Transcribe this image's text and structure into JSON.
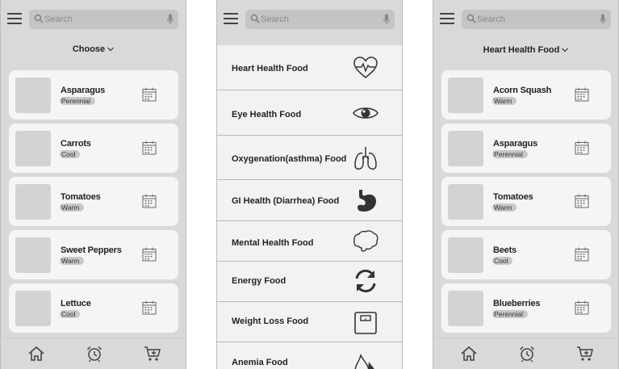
{
  "search": {
    "placeholder": "Search"
  },
  "screen1": {
    "chooser": "Choose",
    "items": [
      {
        "name": "Asparagus",
        "tag": "Perennial"
      },
      {
        "name": "Carrots",
        "tag": "Cool"
      },
      {
        "name": "Tomatoes",
        "tag": "Warm"
      },
      {
        "name": "Sweet Peppers",
        "tag": "Warm"
      },
      {
        "name": "Lettuce",
        "tag": "Cool"
      }
    ]
  },
  "screen2": {
    "menu": [
      {
        "label": "Heart Health Food",
        "icon": "heart-pulse-icon"
      },
      {
        "label": "Eye Health Food",
        "icon": "eye-icon"
      },
      {
        "label": "Oxygenation(asthma) Food",
        "icon": "lungs-icon"
      },
      {
        "label": "GI Health (Diarrhea) Food",
        "icon": "stomach-icon"
      },
      {
        "label": "Mental Health Food",
        "icon": "brain-icon"
      },
      {
        "label": "Energy Food",
        "icon": "refresh-icon"
      },
      {
        "label": "Weight Loss Food",
        "icon": "scale-icon"
      },
      {
        "label": "Anemia Food",
        "icon": "blood-drop-icon"
      }
    ]
  },
  "screen3": {
    "chooser": "Heart Health Food",
    "items": [
      {
        "name": "Acorn Squash",
        "tag": "Warm"
      },
      {
        "name": "Asparagus",
        "tag": "Perennial"
      },
      {
        "name": "Tomatoes",
        "tag": "Warm"
      },
      {
        "name": "Beets",
        "tag": "Cool"
      },
      {
        "name": "Blueberries",
        "tag": "Perennial"
      }
    ]
  },
  "bottom_nav": [
    {
      "icon": "home-icon"
    },
    {
      "icon": "alarm-clock-icon"
    },
    {
      "icon": "cart-add-icon"
    }
  ],
  "colors": {
    "background": "#d9d9d9",
    "card": "#f5f5f5",
    "tag": "#c8c8c8",
    "search": "#c4c4c4"
  }
}
